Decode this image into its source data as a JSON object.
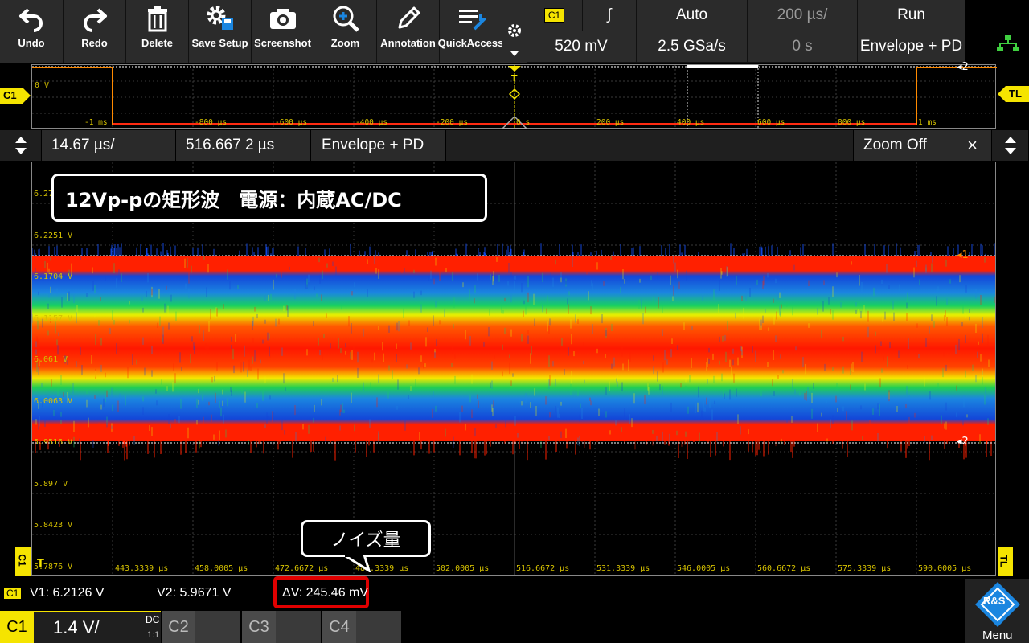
{
  "toolbar": {
    "undo": "Undo",
    "redo": "Redo",
    "delete": "Delete",
    "save_setup": "Save Setup",
    "screenshot": "Screenshot",
    "zoom": "Zoom",
    "annotation": "Annotation",
    "quick_access": "QuickAccess"
  },
  "params": {
    "channel_badge": "C1",
    "trigger_slope": "∫",
    "trigger_mode": "Auto",
    "time_scale": "200 µs/",
    "run_state": "Run",
    "trigger_level": "520 mV",
    "sample_rate": "2.5 GSa/s",
    "time_offset": "0 s",
    "acq_mode": "Envelope + PD"
  },
  "overview": {
    "channel_tag": "C1",
    "level_label": "0 V",
    "trigger_tag": "TL",
    "marker2": "2",
    "time_labels": [
      "-1 ms",
      "-800 µs",
      "-600 µs",
      "-400 µs",
      "-200 µs",
      "0 s",
      "200 µs",
      "400 µs",
      "600 µs",
      "800 µs",
      "1 ms"
    ]
  },
  "zoom_bar": {
    "time_scale": "14.67 µs/",
    "position": "516.667 2 µs",
    "mode": "Envelope + PD",
    "zoom_off": "Zoom Off",
    "close": "×"
  },
  "plot": {
    "y_labels": [
      "6.2797 V",
      "6.2251 V",
      "6.1704 V",
      "6.1157 V",
      "6.061 V",
      "6.0063 V",
      "5.9516 V",
      "5.897 V",
      "5.8423 V",
      "5.7876 V"
    ],
    "x_labels": [
      "443.3339 µs",
      "458.0005 µs",
      "472.6672 µs",
      "487.3339 µs",
      "502.0005 µs",
      "516.6672 µs",
      "531.3339 µs",
      "546.0005 µs",
      "560.6672 µs",
      "575.3339 µs",
      "590.0005 µs"
    ],
    "cursor1_tag": "1",
    "cursor2_tag": "2",
    "left_tag": "C1",
    "right_tag": "TL",
    "trigger_marker": "T",
    "title_callout": "12Vp-pの矩形波　電源：内蔵AC/DC",
    "noise_callout": "ノイズ量"
  },
  "measure": {
    "badge": "C1",
    "v1": "V1: 6.2126 V",
    "v2": "V2: 5.9671 V",
    "dv": "ΔV: 245.46 mV"
  },
  "channels": {
    "c1_label": "C1",
    "c1_scale": "1.4 V/",
    "c1_coupling": "DC",
    "c1_ratio": "1:1",
    "c2_label": "C2",
    "c3_label": "C3",
    "c4_label": "C4"
  },
  "menu": {
    "label": "Menu",
    "logo": "R&S"
  },
  "colors": {
    "channel1": "#f5e400",
    "trace": "#ff2a10",
    "accent_blue": "#1b86e0",
    "highlight_red": "#e00000"
  }
}
